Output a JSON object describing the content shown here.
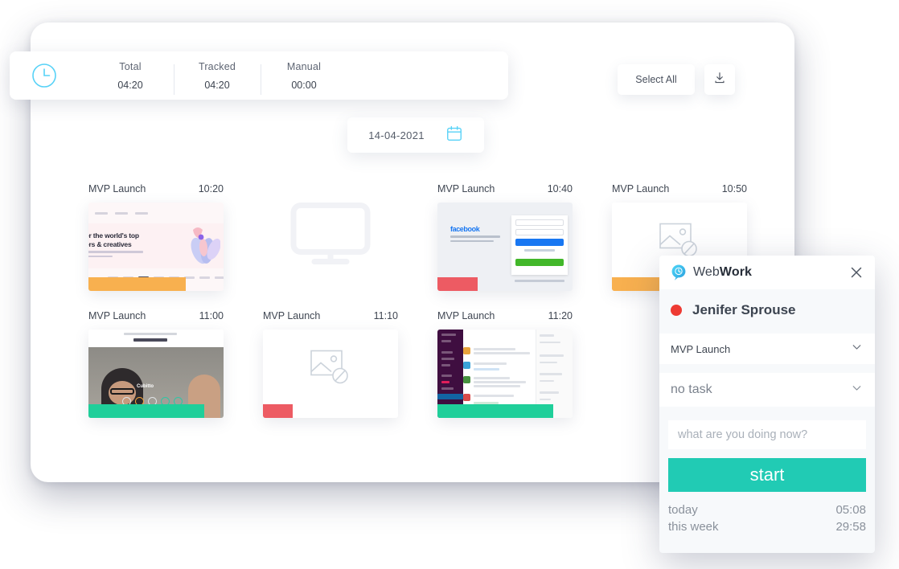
{
  "stats": {
    "icon": "clock-icon",
    "items": [
      {
        "label": "Total",
        "value": "04:20"
      },
      {
        "label": "Tracked",
        "value": "04:20"
      },
      {
        "label": "Manual",
        "value": "00:00"
      }
    ]
  },
  "toolbar": {
    "select_all_label": "Select All",
    "export_icon": "download-icon"
  },
  "date_picker": {
    "value": "14-04-2021",
    "icon": "calendar-icon"
  },
  "screenshots": [
    {
      "title": "MVP Launch",
      "time": "10:20",
      "kind": "design-site",
      "bar_color": "#f8b04f",
      "bar_width": "72%"
    },
    {
      "title": "",
      "time": "",
      "kind": "monitor",
      "bar_color": "",
      "bar_width": "0%"
    },
    {
      "title": "MVP Launch",
      "time": "10:40",
      "kind": "facebook",
      "bar_color": "#ed5b63",
      "bar_width": "30%"
    },
    {
      "title": "MVP Launch",
      "time": "10:50",
      "kind": "broken-image",
      "bar_color": "#f8b04f",
      "bar_width": "53%"
    },
    {
      "title": "MVP Launch",
      "time": "11:00",
      "kind": "video-call",
      "bar_color": "#1fcf9a",
      "bar_width": "86%"
    },
    {
      "title": "MVP Launch",
      "time": "11:10",
      "kind": "broken-image",
      "bar_color": "#ed5b63",
      "bar_width": "22%"
    },
    {
      "title": "MVP Launch",
      "time": "11:20",
      "kind": "slack",
      "bar_color": "#1fcf9a",
      "bar_width": "86%"
    },
    {
      "title": "",
      "time": "",
      "kind": "none",
      "bar_color": "",
      "bar_width": "0%"
    }
  ],
  "popup": {
    "brand_light": "Web",
    "brand_bold": "Work",
    "logo_icon": "webwork-logo-icon",
    "close_icon": "close-icon",
    "status_indicator": "status-dot-offline",
    "user_name": "Jenifer Sprouse",
    "project_value": "MVP Launch",
    "task_value": "no task",
    "description_placeholder": "what are you doing now?",
    "start_label": "start",
    "totals": [
      {
        "label": "today",
        "value": "05:08"
      },
      {
        "label": "this week",
        "value": "29:58"
      }
    ]
  },
  "colors": {
    "accent_cyan": "#55d0f5",
    "teal": "#21cbb4",
    "red": "#ee3b33",
    "orange": "#f8b04f",
    "green": "#1fcf9a",
    "pink_red": "#ed5b63"
  }
}
